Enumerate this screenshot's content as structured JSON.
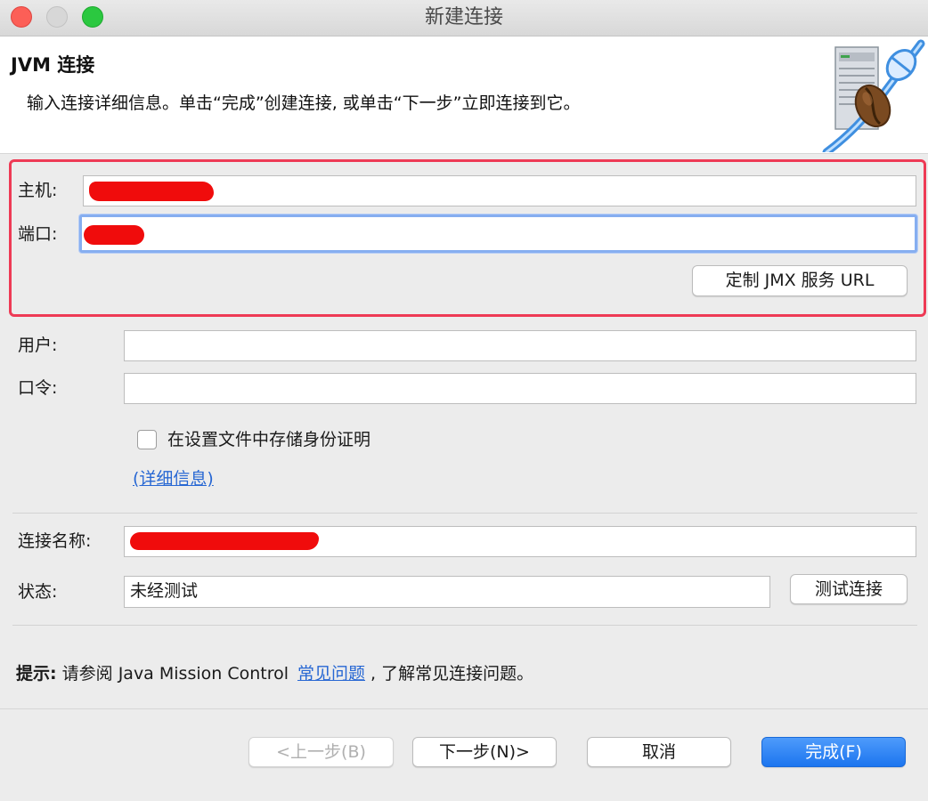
{
  "window": {
    "title": "新建连接"
  },
  "header": {
    "title": "JVM 连接",
    "description": "输入连接详细信息。单击“完成”创建连接, 或单击“下一步”立即连接到它。",
    "art_icon": "jvm-coffee-server-icon"
  },
  "connection": {
    "host_label": "主机:",
    "host_value": "",
    "port_label": "端口:",
    "port_value": "",
    "custom_url_button": "定制 JMX 服务 URL"
  },
  "credentials": {
    "user_label": "用户:",
    "user_value": "",
    "password_label": "口令:",
    "password_value": "",
    "store_checkbox_label": "在设置文件中存储身份证明",
    "store_checked": false,
    "details_link": "(详细信息)"
  },
  "status": {
    "name_label": "连接名称:",
    "name_value": "",
    "state_label": "状态:",
    "state_value": "未经测试",
    "test_button": "测试连接"
  },
  "hint": {
    "prefix": "提示:",
    "text_before": "请参阅 Java Mission Control",
    "link": "常见问题",
    "text_after": ", 了解常见连接问题。"
  },
  "footer": {
    "back": "<上一步(B)",
    "next": "下一步(N)>",
    "cancel": "取消",
    "finish": "完成(F)"
  },
  "colors": {
    "highlight_border": "#ee3a55",
    "primary_button": "#1c75ef",
    "link": "#2767d3",
    "redaction": "#f00c0c"
  }
}
